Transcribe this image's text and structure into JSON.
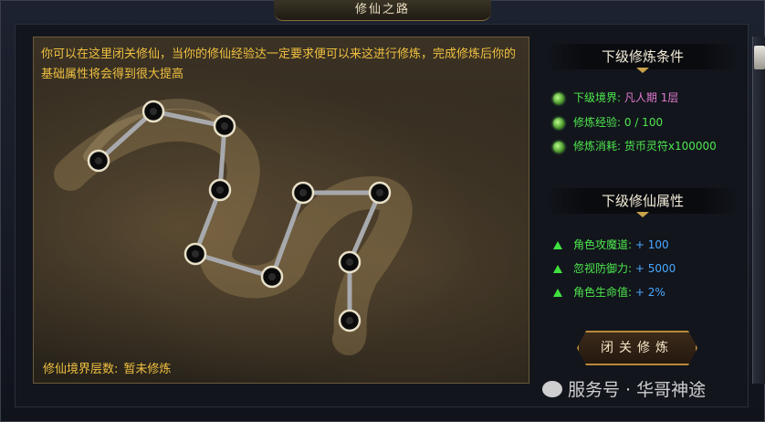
{
  "window": {
    "title": "修仙之路"
  },
  "map": {
    "intro": "你可以在这里闭关修仙，当你的修仙经验达一定要求便可以来这进行修炼，完成修炼后你的基础属性将会得到很大提高",
    "realm_label": "修仙境界层数:",
    "realm_value": "暂未修炼"
  },
  "conditions": {
    "heading": "下级修炼条件",
    "items": [
      {
        "key": "下级境界:",
        "value": "凡人期 1层"
      },
      {
        "key": "修炼经验:",
        "value": "0 / 100"
      },
      {
        "key": "修炼消耗:",
        "value": "货币灵符x100000"
      }
    ]
  },
  "attributes": {
    "heading": "下级修仙属性",
    "items": [
      {
        "key": "角色攻魔道:",
        "value": "+ 100"
      },
      {
        "key": "忽视防御力:",
        "value": "+ 5000"
      },
      {
        "key": "角色生命值:",
        "value": "+ 2%"
      }
    ]
  },
  "button": {
    "label": "闭关修炼"
  },
  "watermark": "服务号 · 华哥神途",
  "colors": {
    "gold_text": "#f0c040",
    "green_text": "#4ee84e",
    "pink_text": "#e07ad0",
    "blue_text": "#4aa8ff"
  }
}
